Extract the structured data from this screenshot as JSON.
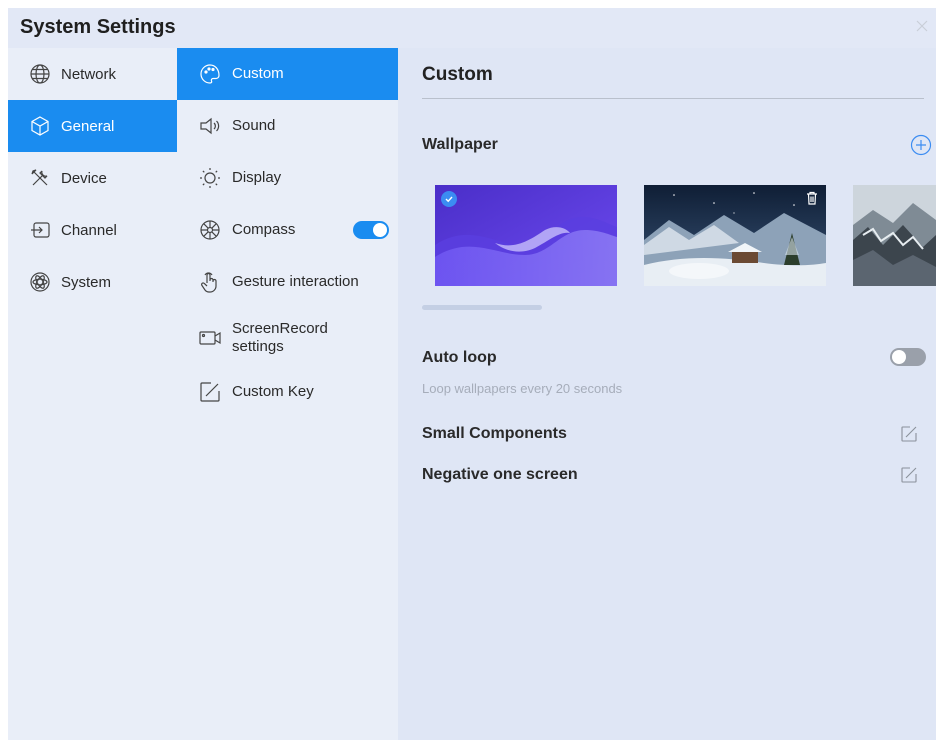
{
  "window": {
    "title": "System Settings",
    "close_icon": "close-icon"
  },
  "nav_main": {
    "items": [
      {
        "label": "Network",
        "icon": "globe-icon",
        "active": false
      },
      {
        "label": "General",
        "icon": "cube-icon",
        "active": true
      },
      {
        "label": "Device",
        "icon": "tools-icon",
        "active": false
      },
      {
        "label": "Channel",
        "icon": "input-icon",
        "active": false
      },
      {
        "label": "System",
        "icon": "atom-icon",
        "active": false
      }
    ]
  },
  "nav_sub": {
    "items": [
      {
        "label": "Custom",
        "icon": "palette-icon",
        "active": true
      },
      {
        "label": "Sound",
        "icon": "speaker-icon",
        "active": false
      },
      {
        "label": "Display",
        "icon": "sun-icon",
        "active": false
      },
      {
        "label": "Compass",
        "icon": "compass-icon",
        "active": false,
        "toggle": true
      },
      {
        "label": "Gesture interaction",
        "icon": "hand-pointer-icon",
        "active": false
      },
      {
        "label": "ScreenRecord settings",
        "icon": "screen-record-icon",
        "active": false
      },
      {
        "label": "Custom Key",
        "icon": "edit-key-icon",
        "active": false
      }
    ]
  },
  "content": {
    "title": "Custom",
    "wallpaper": {
      "label": "Wallpaper",
      "add_icon": "plus-circle-icon",
      "selected_index": 0
    },
    "auto_loop": {
      "label": "Auto loop",
      "enabled": false,
      "description": "Loop wallpapers every 20 seconds"
    },
    "small_components": {
      "label": "Small Components",
      "icon": "edit-icon"
    },
    "negative_one_screen": {
      "label": "Negative one screen",
      "icon": "edit-icon"
    }
  },
  "colors": {
    "accent": "#1a8cf0",
    "panel": "#e9eef8",
    "content_bg": "#dfe6f5",
    "muted_text": "#a6adba"
  }
}
